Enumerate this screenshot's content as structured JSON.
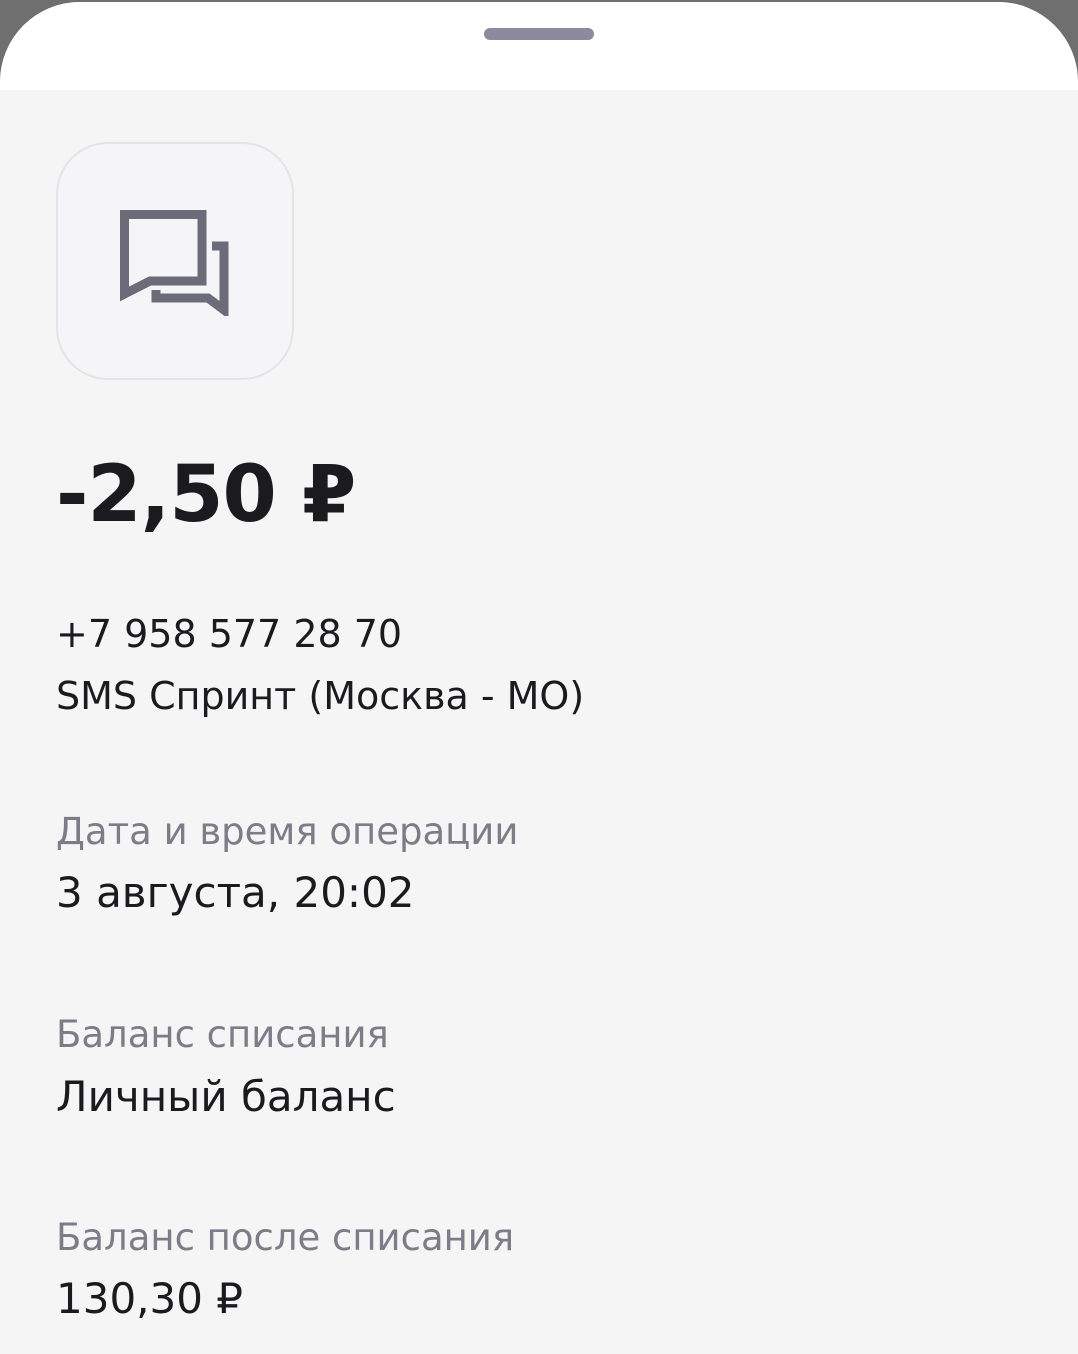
{
  "transaction": {
    "icon": "chat-bubbles-icon",
    "amount": "-2,50 ₽",
    "phone": "+7 958 577 28 70",
    "service": "SMS Спринт (Москва - МО)"
  },
  "details": [
    {
      "label": "Дата и время операции",
      "value": "3 августа, 20:02"
    },
    {
      "label": "Баланс списания",
      "value": "Личный баланс"
    },
    {
      "label": "Баланс после списания",
      "value": "130,30 ₽"
    }
  ],
  "colors": {
    "icon": "#6c6b7a",
    "label": "#7d7c88",
    "text": "#1b1b1f",
    "grabber": "#8c8a9c"
  }
}
